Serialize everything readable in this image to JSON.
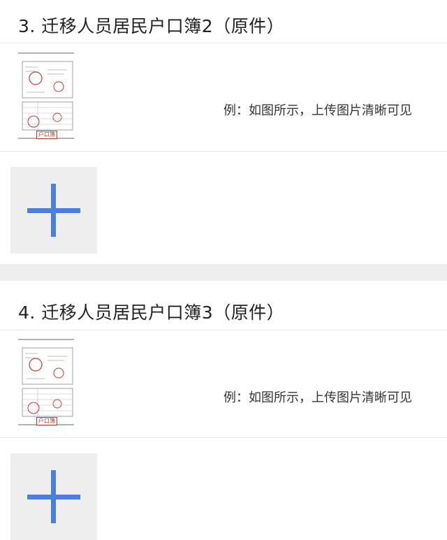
{
  "sections": [
    {
      "title": "3. 迁移人员居民户口簿2（原件）",
      "example_hint": "例：如图所示，上传图片清晰可见",
      "example_stamp_text": "户口簿",
      "example_icon": "household-register-sample-image",
      "upload_icon": "plus-icon"
    },
    {
      "title": "4. 迁移人员居民户口簿3（原件）",
      "example_hint": "例：如图所示，上传图片清晰可见",
      "example_stamp_text": "户口簿",
      "example_icon": "household-register-sample-image",
      "upload_icon": "plus-icon"
    }
  ],
  "colors": {
    "plus_accent": "#4a7fdc",
    "upload_bg": "#eeeeee",
    "separator_band": "#eeeeee",
    "stamp_red": "#c0392b"
  }
}
